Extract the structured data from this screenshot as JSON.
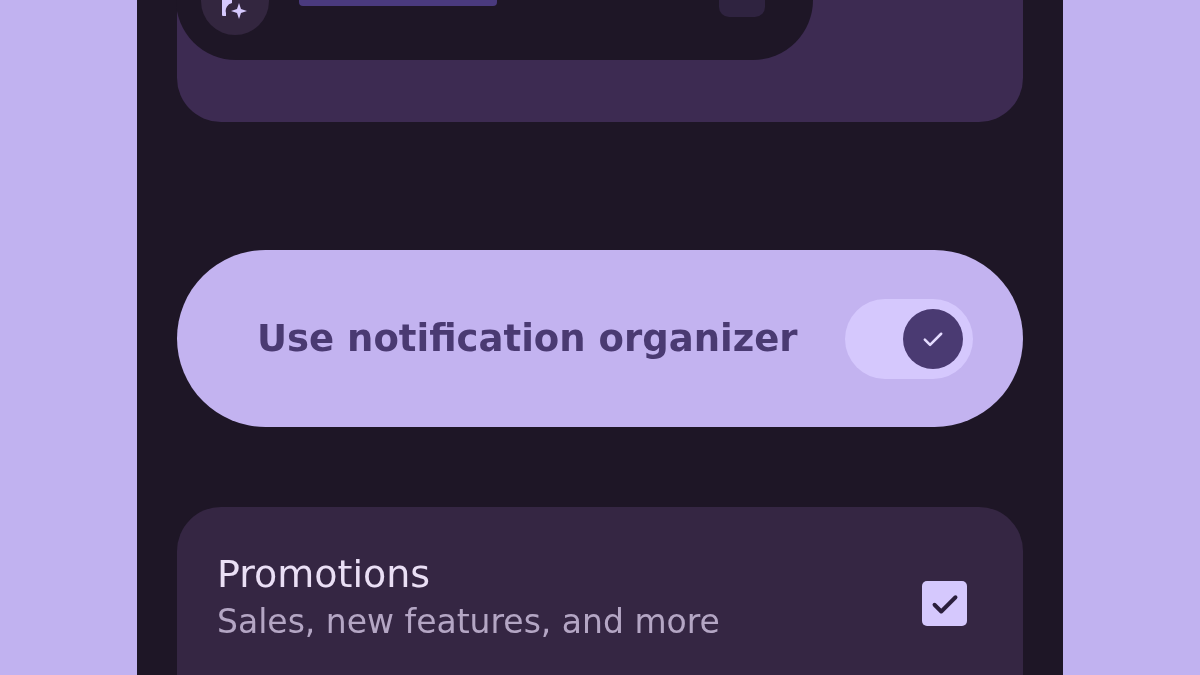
{
  "organizer_toggle": {
    "label": "Use notification organizer",
    "on": true
  },
  "categories": [
    {
      "title": "Promotions",
      "subtitle": "Sales, new features, and more",
      "checked": true
    }
  ]
}
